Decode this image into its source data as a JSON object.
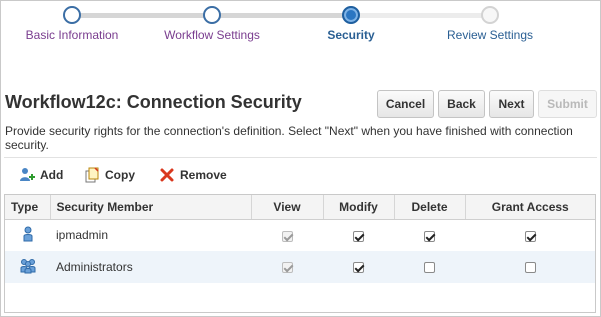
{
  "train": {
    "steps": [
      {
        "label": "Basic Information",
        "state": "visited"
      },
      {
        "label": "Workflow Settings",
        "state": "visited"
      },
      {
        "label": "Security",
        "state": "current"
      },
      {
        "label": "Review Settings",
        "state": "future"
      }
    ]
  },
  "header": {
    "title": "Workflow12c: Connection Security",
    "buttons": {
      "cancel": "Cancel",
      "back": "Back",
      "next": "Next",
      "submit": "Submit"
    },
    "instructions": "Provide security rights for the connection's definition. Select \"Next\" when you have finished with connection security."
  },
  "toolbar": {
    "add": {
      "label": "Add",
      "icon": "add-user-icon"
    },
    "copy": {
      "label": "Copy",
      "icon": "copy-icon"
    },
    "remove": {
      "label": "Remove",
      "icon": "remove-x-icon"
    }
  },
  "table": {
    "columns": [
      "Type",
      "Security Member",
      "View",
      "Modify",
      "Delete",
      "Grant Access"
    ],
    "rows": [
      {
        "type_icon": "user-icon",
        "member": "ipmadmin",
        "view": true,
        "view_disabled": true,
        "modify": true,
        "delete": true,
        "grant": true
      },
      {
        "type_icon": "group-icon",
        "member": "Administrators",
        "view": true,
        "view_disabled": true,
        "modify": true,
        "delete": false,
        "grant": false
      }
    ]
  },
  "colors": {
    "accent": "#2b76c2",
    "visited_link": "#7a3d8f",
    "remove_red": "#d9381e",
    "selected_row": "#eef4fa"
  }
}
